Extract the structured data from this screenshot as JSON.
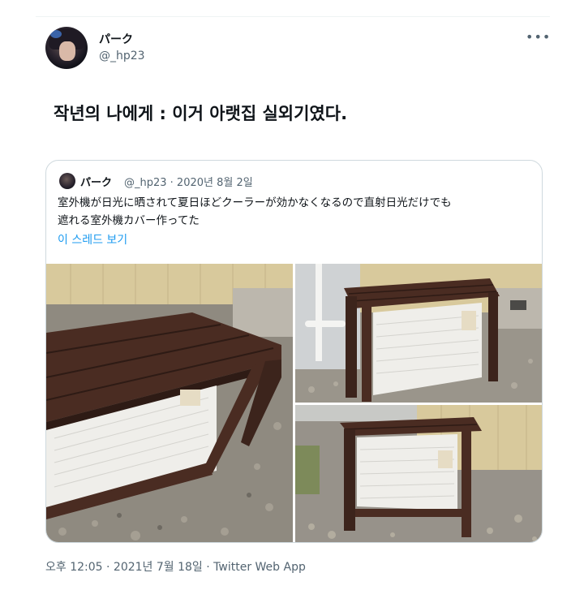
{
  "tweet": {
    "author": {
      "display_name": "パーク",
      "handle": "@_hp23"
    },
    "more_icon": "more-horizontal-icon",
    "text": "작년의 나에게 : 이거 아랫집 실외기였다.",
    "timestamp": "오후 12:05 · 2021년 7월 18일 · Twitter Web App"
  },
  "quote": {
    "author": {
      "display_name": "パーク",
      "handle_date": "@_hp23 · 2020년 8월 2일"
    },
    "text_line1": "室外機が日光に晒されて夏日ほどクーラーが効かなくなるので直射日光だけでも",
    "text_line2": "遮れる室外機カバー作ってた",
    "thread_link": "이 스레드 보기",
    "images": [
      {
        "alt": "wooden AC cover, angled view"
      },
      {
        "alt": "wooden AC cover, side view"
      },
      {
        "alt": "wooden AC cover, front view"
      }
    ]
  },
  "colors": {
    "text_primary": "#0f1419",
    "text_secondary": "#536471",
    "link": "#1d9bf0",
    "border": "#cfd9de",
    "wood": "#4a2c22",
    "siding": "#d9c9a0",
    "unit": "#f1f1ee"
  }
}
